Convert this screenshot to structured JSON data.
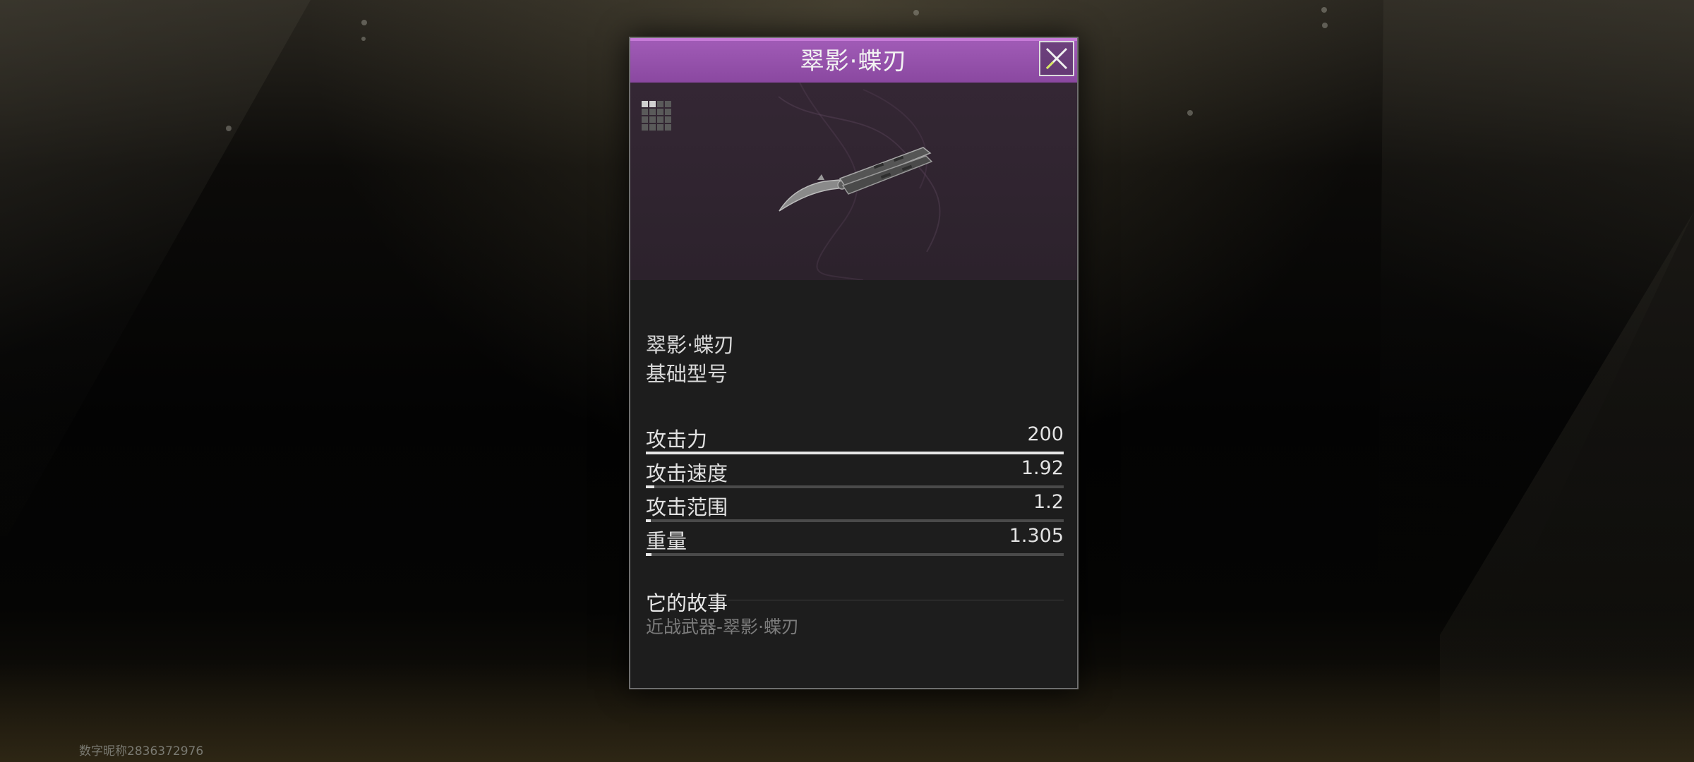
{
  "panel": {
    "title": "翠影·蝶刃",
    "close_icon": "close-x-icon",
    "rarity_color": "#8a48a0"
  },
  "preview": {
    "grid_icon": "inventory-grid-icon",
    "weapon_icon": "butterfly-knife"
  },
  "info": {
    "name": "翠影·蝶刃",
    "model": "基础型号"
  },
  "stats": [
    {
      "label": "攻击力",
      "value": "200",
      "fill": 1.0
    },
    {
      "label": "攻击速度",
      "value": "1.92",
      "fill": 0.02
    },
    {
      "label": "攻击范围",
      "value": "1.2",
      "fill": 0.012
    },
    {
      "label": "重量",
      "value": "1.305",
      "fill": 0.013
    }
  ],
  "story": {
    "heading": "它的故事",
    "text": "近战武器-翠影·蝶刃"
  },
  "footer": {
    "nickname": "数字昵称2836372976"
  }
}
